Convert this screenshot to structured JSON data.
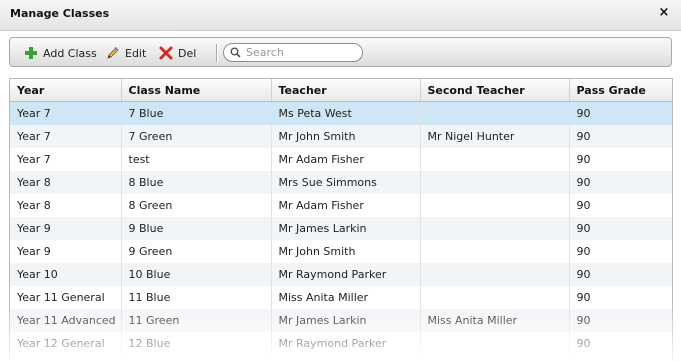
{
  "window": {
    "title": "Manage Classes",
    "close_label": "×"
  },
  "toolbar": {
    "add_label": "Add Class",
    "edit_label": "Edit",
    "del_label": "Del",
    "search_placeholder": "Search",
    "search_value": ""
  },
  "colors": {
    "selected_row": "#cfe6f6",
    "alt_row": "#f2f5f8",
    "add_icon": "#3aa13a",
    "del_icon": "#d42a2a"
  },
  "table": {
    "columns": [
      "Year",
      "Class Name",
      "Teacher",
      "Second Teacher",
      "Pass Grade"
    ],
    "rows": [
      [
        "Year 7",
        "7 Blue",
        "Ms Peta West",
        "",
        "90"
      ],
      [
        "Year 7",
        "7 Green",
        "Mr John Smith",
        "Mr Nigel Hunter",
        "90"
      ],
      [
        "Year 7",
        "test",
        "Mr Adam Fisher",
        "",
        "90"
      ],
      [
        "Year 8",
        "8 Blue",
        "Mrs Sue Simmons",
        "",
        "90"
      ],
      [
        "Year 8",
        "8 Green",
        "Mr Adam Fisher",
        "",
        "90"
      ],
      [
        "Year 9",
        "9 Blue",
        "Mr James Larkin",
        "",
        "90"
      ],
      [
        "Year 9",
        "9 Green",
        "Mr John Smith",
        "",
        "90"
      ],
      [
        "Year 10",
        "10 Blue",
        "Mr Raymond Parker",
        "",
        "90"
      ],
      [
        "Year 11 General",
        "11 Blue",
        "Miss Anita Miller",
        "",
        "90"
      ],
      [
        "Year 11 Advanced",
        "11 Green",
        "Mr James Larkin",
        "Miss Anita Miller",
        "90"
      ],
      [
        "Year 12 General",
        "12 Blue",
        "Mr Raymond Parker",
        "",
        "90"
      ]
    ],
    "selected_row": 0
  }
}
